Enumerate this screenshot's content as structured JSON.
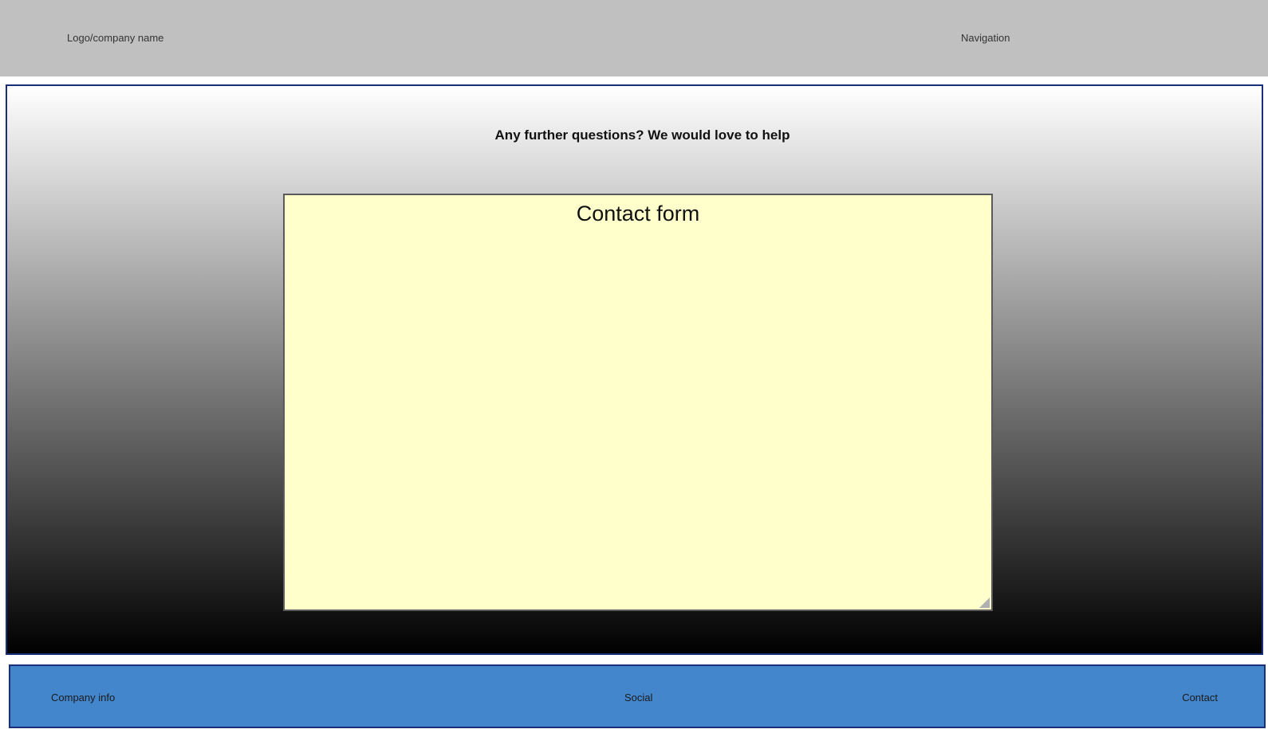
{
  "header": {
    "logo": "Logo/company name",
    "navigation": "Navigation"
  },
  "hero": {
    "heading": "Any further questions? We would love to help"
  },
  "contact_form": {
    "title": "Contact form"
  },
  "footer": {
    "company_info": "Company info",
    "social": "Social",
    "contact": "Contact"
  },
  "colors": {
    "header_bg": "#c0c0c0",
    "hero_border": "#1a2f7a",
    "form_bg": "#ffffcc",
    "footer_bg": "#4486cc"
  }
}
